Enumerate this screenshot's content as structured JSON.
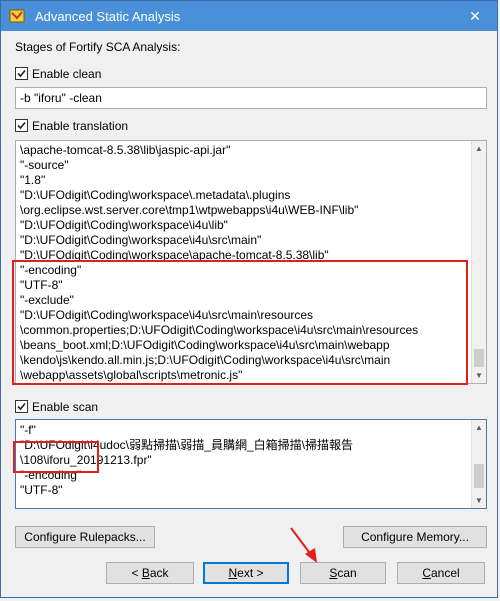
{
  "window": {
    "title": "Advanced Static Analysis",
    "close_glyph": "✕"
  },
  "stages_label": "Stages of Fortify SCA Analysis:",
  "clean": {
    "checkbox_label": "Enable clean",
    "checked": true,
    "args": "-b \"iforu\" -clean"
  },
  "translation": {
    "checkbox_label": "Enable translation",
    "checked": true,
    "lines": [
      "\\apache-tomcat-8.5.38\\lib\\jaspic-api.jar\"",
      "\"-source\"",
      "\"1.8\"",
      "\"D:\\UFOdigit\\Coding\\workspace\\.metadata\\.plugins",
      "\\org.eclipse.wst.server.core\\tmp1\\wtpwebapps\\i4u\\WEB-INF\\lib\"",
      "\"D:\\UFOdigit\\Coding\\workspace\\i4u\\lib\"",
      "\"D:\\UFOdigit\\Coding\\workspace\\i4u\\src\\main\"",
      "\"D:\\UFOdigit\\Coding\\workspace\\apache-tomcat-8.5.38\\lib\"",
      "\"-encoding\"",
      "\"UTF-8\"",
      "\"-exclude\"",
      "\"D:\\UFOdigit\\Coding\\workspace\\i4u\\src\\main\\resources",
      "\\common.properties;D:\\UFOdigit\\Coding\\workspace\\i4u\\src\\main\\resources",
      "\\beans_boot.xml;D:\\UFOdigit\\Coding\\workspace\\i4u\\src\\main\\webapp",
      "\\kendo\\js\\kendo.all.min.js;D:\\UFOdigit\\Coding\\workspace\\i4u\\src\\main",
      "\\webapp\\assets\\global\\scripts\\metronic.js\""
    ]
  },
  "scan": {
    "checkbox_label": "Enable scan",
    "checked": true,
    "lines": [
      "\"-f\"",
      "\"D:\\UFOdigit\\i4udoc\\弱點掃描\\弱描_員購網_白箱掃描\\掃描報告",
      "\\108\\iforu_20191213.fpr\"",
      "\"-encoding\"",
      "\"UTF-8\""
    ]
  },
  "buttons": {
    "configure_rulepacks": "Configure Rulepacks...",
    "configure_memory": "Configure Memory...",
    "back": {
      "prefix": "< ",
      "key": "B",
      "rest": "ack"
    },
    "next": {
      "key": "N",
      "rest": "ext >"
    },
    "scan": {
      "key": "S",
      "rest": "can"
    },
    "cancel": {
      "key": "C",
      "rest": "ancel"
    }
  },
  "colors": {
    "titlebar": "#4a90d9",
    "highlight": "#e0201f",
    "default_button": "#0078d7"
  },
  "icons": {
    "app": "fortify-app-icon",
    "close": "close-icon",
    "check": "checkmark-icon",
    "annotation": "red-arrow"
  }
}
